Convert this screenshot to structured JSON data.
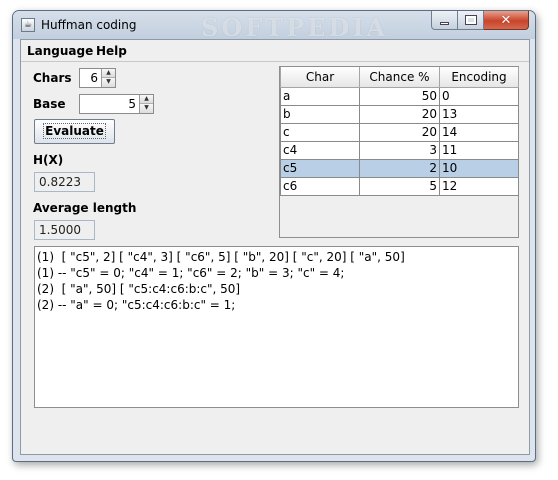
{
  "window": {
    "title": "Huffman coding",
    "watermark": "SOFTPEDIA",
    "app_icon": "java-cup-icon"
  },
  "menu": {
    "items": [
      {
        "label": "Language"
      },
      {
        "label": "Help"
      }
    ]
  },
  "controls": {
    "chars_label": "Chars",
    "chars_value": "6",
    "base_label": "Base",
    "base_value": "5",
    "evaluate_label": "Evaluate",
    "hx_label": "H(X)",
    "hx_value": "0.8223",
    "avg_label": "Average length",
    "avg_value": "1.5000"
  },
  "table": {
    "columns": [
      "Char",
      "Chance %",
      "Encoding"
    ],
    "rows": [
      {
        "char": "a",
        "chance": "50",
        "encoding": "0"
      },
      {
        "char": "b",
        "chance": "20",
        "encoding": "13"
      },
      {
        "char": "c",
        "chance": "20",
        "encoding": "14"
      },
      {
        "char": "c4",
        "chance": "3",
        "encoding": "11"
      },
      {
        "char": "c5",
        "chance": "2",
        "encoding": "10"
      },
      {
        "char": "c6",
        "chance": "5",
        "encoding": "12"
      }
    ],
    "selected_row": 4
  },
  "log": {
    "lines": [
      "(1)  [ \"c5\", 2] [ \"c4\", 3] [ \"c6\", 5] [ \"b\", 20] [ \"c\", 20] [ \"a\", 50]",
      "(1) -- \"c5\" = 0; \"c4\" = 1; \"c6\" = 2; \"b\" = 3; \"c\" = 4;",
      "(2)  [ \"a\", 50] [ \"c5:c4:c6:b:c\", 50]",
      "(2) -- \"a\" = 0; \"c5:c4:c6:b:c\" = 1;"
    ]
  },
  "colors": {
    "selection": "#b8cfe5",
    "window_frame": "#c2cfde",
    "close_button": "#c9442a"
  }
}
